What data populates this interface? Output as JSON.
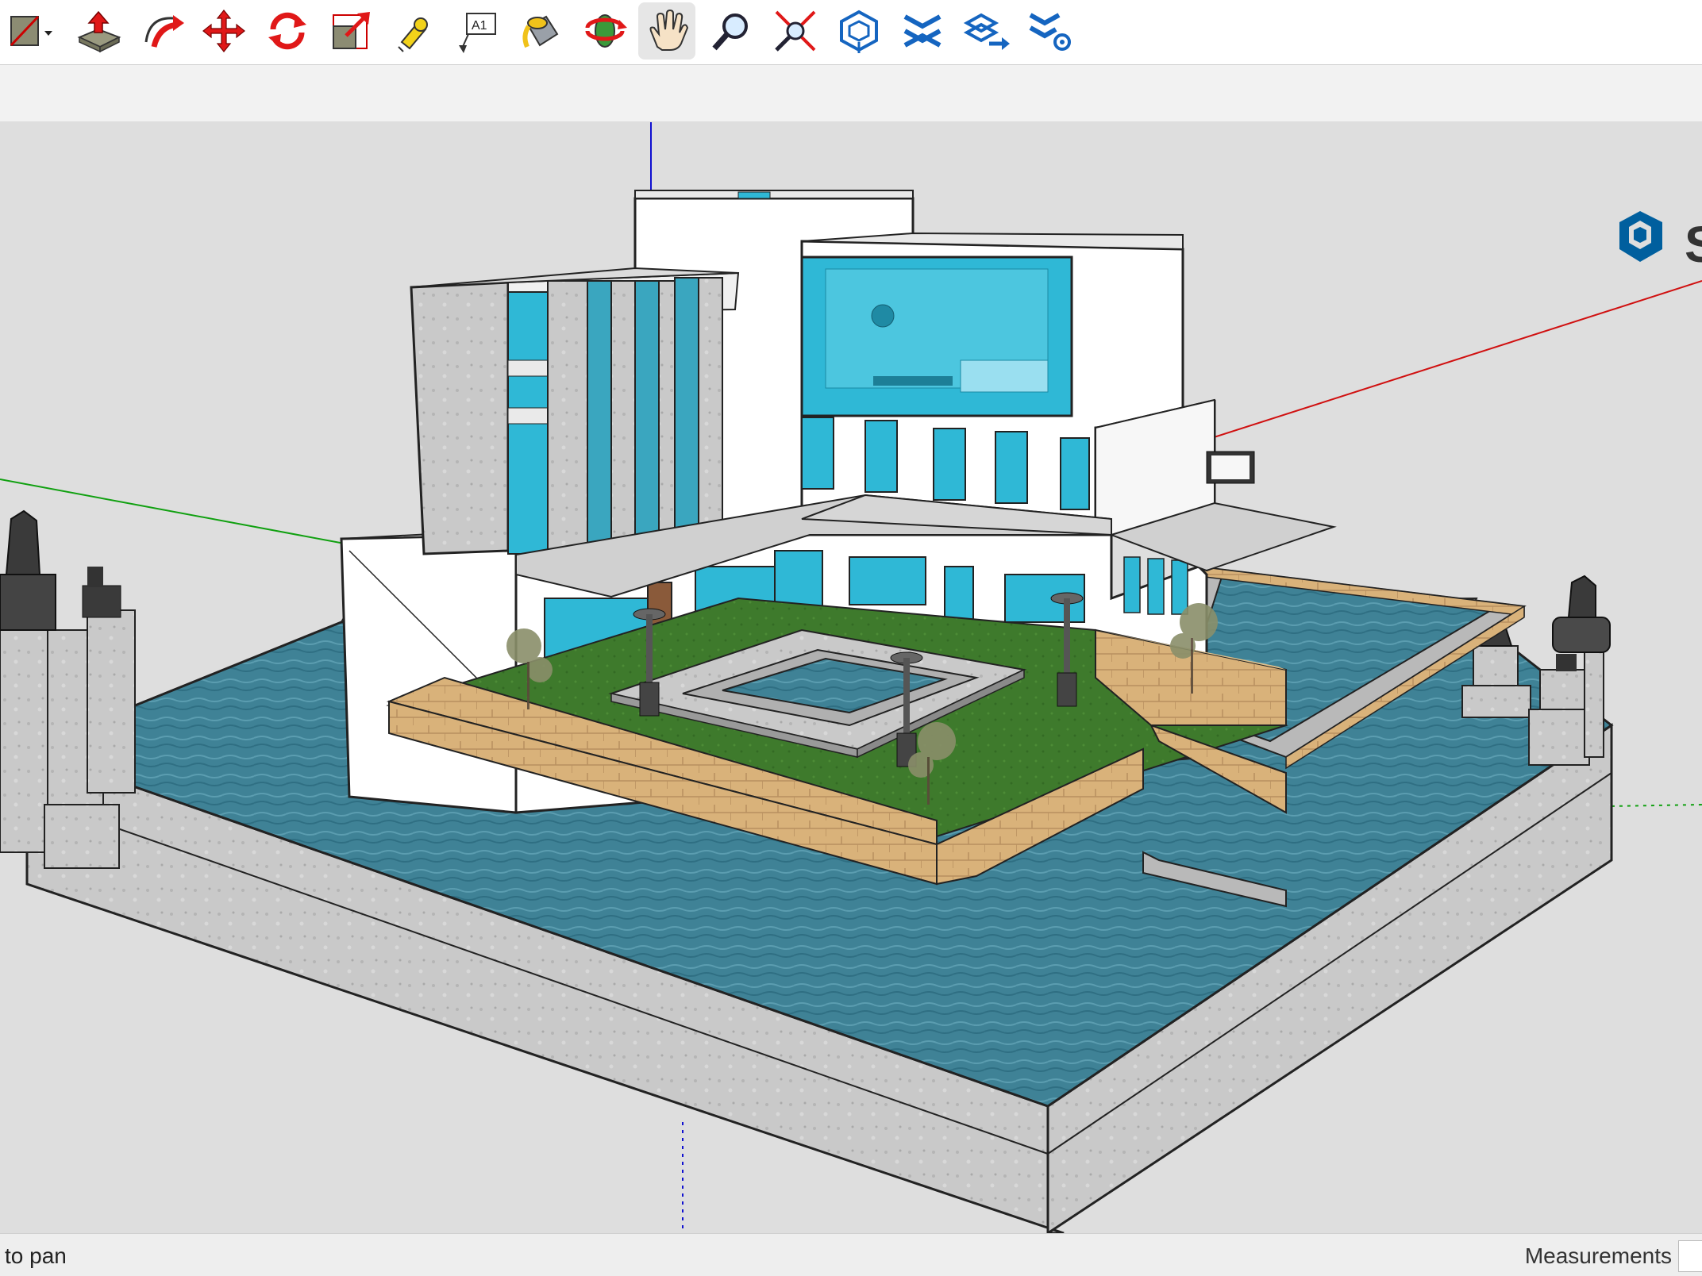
{
  "toolbar": {
    "tools": [
      {
        "id": "line",
        "icon": "line-pencil-icon"
      },
      {
        "id": "push-pull",
        "icon": "push-pull-icon"
      },
      {
        "id": "follow-me",
        "icon": "follow-me-icon"
      },
      {
        "id": "move",
        "icon": "move-icon"
      },
      {
        "id": "rotate",
        "icon": "rotate-icon"
      },
      {
        "id": "scale",
        "icon": "scale-icon"
      },
      {
        "id": "tape-measure",
        "icon": "tape-measure-icon"
      },
      {
        "id": "text",
        "icon": "text-label-icon",
        "glyph": "A1"
      },
      {
        "id": "paint-bucket",
        "icon": "paint-bucket-icon"
      },
      {
        "id": "orbit",
        "icon": "orbit-icon"
      },
      {
        "id": "pan",
        "icon": "pan-hand-icon",
        "active": true
      },
      {
        "id": "zoom",
        "icon": "zoom-icon"
      },
      {
        "id": "zoom-extents",
        "icon": "zoom-extents-icon"
      },
      {
        "id": "warehouse",
        "icon": "3d-warehouse-icon"
      },
      {
        "id": "extension-warehouse",
        "icon": "extension-warehouse-icon"
      },
      {
        "id": "send-to-layout",
        "icon": "send-to-layout-icon"
      },
      {
        "id": "extension-manager",
        "icon": "extension-manager-icon"
      }
    ]
  },
  "status": {
    "hint": "to pan",
    "measurements_label": "Measurements"
  },
  "viewport": {
    "logo_letter": "S",
    "colors": {
      "background": "#dedede",
      "water": "#3d7f93",
      "grass": "#3f7a2c",
      "glass": "#2fb8d6",
      "axis_red": "#d01010",
      "axis_green": "#10a010",
      "axis_blue": "#1010d0",
      "brand": "#005f9e"
    }
  }
}
